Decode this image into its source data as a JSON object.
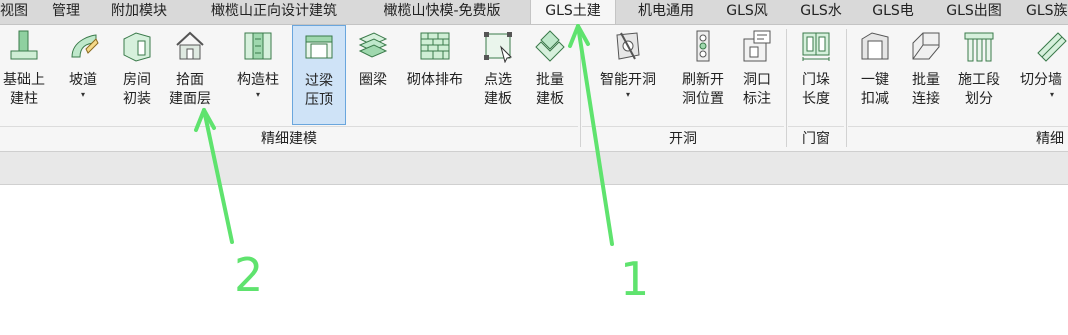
{
  "tabs": [
    {
      "label": "视图"
    },
    {
      "label": "管理"
    },
    {
      "label": "附加模块"
    },
    {
      "label": "橄榄山正向设计建筑"
    },
    {
      "label": "橄榄山快模-免费版"
    },
    {
      "label": "GLS土建",
      "active": true
    },
    {
      "label": "机电通用"
    },
    {
      "label": "GLS风"
    },
    {
      "label": "GLS水"
    },
    {
      "label": "GLS电"
    },
    {
      "label": "GLS出图"
    },
    {
      "label": "GLS族"
    }
  ],
  "ribbon": {
    "buttons": [
      {
        "line1": "基础上",
        "line2": "建柱",
        "icon": "column-base-icon"
      },
      {
        "line1": "坡道",
        "line2": "▾",
        "icon": "ramp-icon"
      },
      {
        "line1": "房间",
        "line2": "初装",
        "icon": "room-finish-icon"
      },
      {
        "line1": "拾面",
        "line2": "建面层",
        "icon": "house-surface-icon"
      },
      {
        "line1": "构造柱",
        "line2": "▾",
        "icon": "structural-column-icon"
      },
      {
        "line1": "过梁",
        "line2": "压顶",
        "icon": "lintel-icon",
        "selected": true
      },
      {
        "line1": "圈梁",
        "line2": "",
        "icon": "ring-beam-icon"
      },
      {
        "line1": "砌体排布",
        "line2": "",
        "icon": "masonry-icon"
      },
      {
        "line1": "点选",
        "line2": "建板",
        "icon": "pick-slab-icon"
      },
      {
        "line1": "批量",
        "line2": "建板",
        "icon": "batch-slab-icon"
      },
      {
        "line1": "智能开洞",
        "line2": "▾",
        "icon": "smart-opening-icon"
      },
      {
        "line1": "刷新开",
        "line2": "洞位置",
        "icon": "refresh-opening-icon"
      },
      {
        "line1": "洞口",
        "line2": "标注",
        "icon": "opening-tag-icon"
      },
      {
        "line1": "门垛",
        "line2": "长度",
        "icon": "door-jamb-icon"
      },
      {
        "line1": "一键",
        "line2": "扣减",
        "icon": "one-key-deduct-icon"
      },
      {
        "line1": "批量",
        "line2": "连接",
        "icon": "batch-join-icon"
      },
      {
        "line1": "施工段",
        "line2": "划分",
        "icon": "construction-segment-icon"
      },
      {
        "line1": "切分墙",
        "line2": "▾",
        "icon": "split-wall-icon"
      }
    ],
    "groups": [
      {
        "label": "精细建模"
      },
      {
        "label": "开洞"
      },
      {
        "label": "门窗"
      },
      {
        "label": "精细"
      }
    ]
  },
  "annotations": [
    {
      "text": "2"
    },
    {
      "text": "1"
    }
  ],
  "colors": {
    "annotation": "#5fe36e",
    "selected_bg": "#cfe3f7",
    "selected_border": "#6aa6dd"
  }
}
